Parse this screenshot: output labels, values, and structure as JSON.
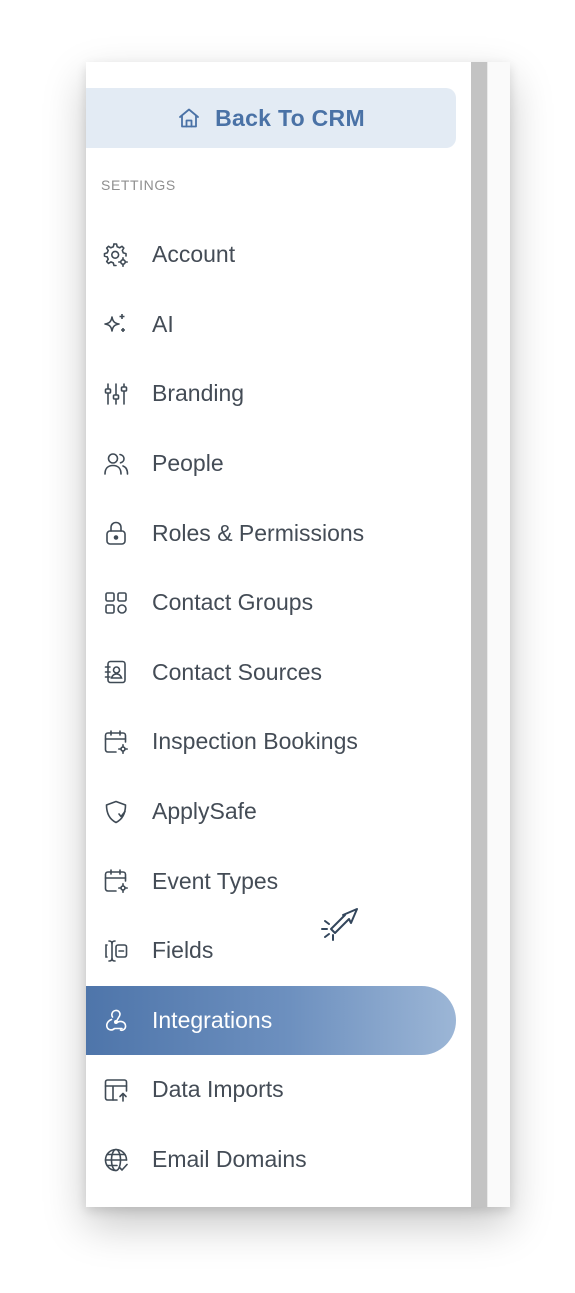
{
  "sidebar": {
    "back_label": "Back To CRM",
    "section_label": "SETTINGS",
    "items": [
      {
        "label": "Account",
        "icon": "gear-icon"
      },
      {
        "label": "AI",
        "icon": "sparkle-icon"
      },
      {
        "label": "Branding",
        "icon": "sliders-icon"
      },
      {
        "label": "People",
        "icon": "users-icon"
      },
      {
        "label": "Roles & Permissions",
        "icon": "lock-icon"
      },
      {
        "label": "Contact Groups",
        "icon": "grid-icon"
      },
      {
        "label": "Contact Sources",
        "icon": "contact-book-icon"
      },
      {
        "label": "Inspection Bookings",
        "icon": "calendar-gear-icon"
      },
      {
        "label": "ApplySafe",
        "icon": "shield-icon"
      },
      {
        "label": "Event Types",
        "icon": "calendar-gear-icon"
      },
      {
        "label": "Fields",
        "icon": "text-field-icon"
      },
      {
        "label": "Integrations",
        "icon": "webhook-icon"
      },
      {
        "label": "Data Imports",
        "icon": "table-upload-icon"
      },
      {
        "label": "Email Domains",
        "icon": "globe-icon"
      }
    ],
    "active_item": "Integrations"
  },
  "colors": {
    "accent": "#4a72a6",
    "back_button_bg": "#e3ebf4",
    "active_gradient_start": "#4e75aa",
    "active_gradient_end": "#9cb6d6",
    "text": "#444c56",
    "section_label": "#8f8f8f",
    "scrollbar": "#c3c3c3"
  }
}
